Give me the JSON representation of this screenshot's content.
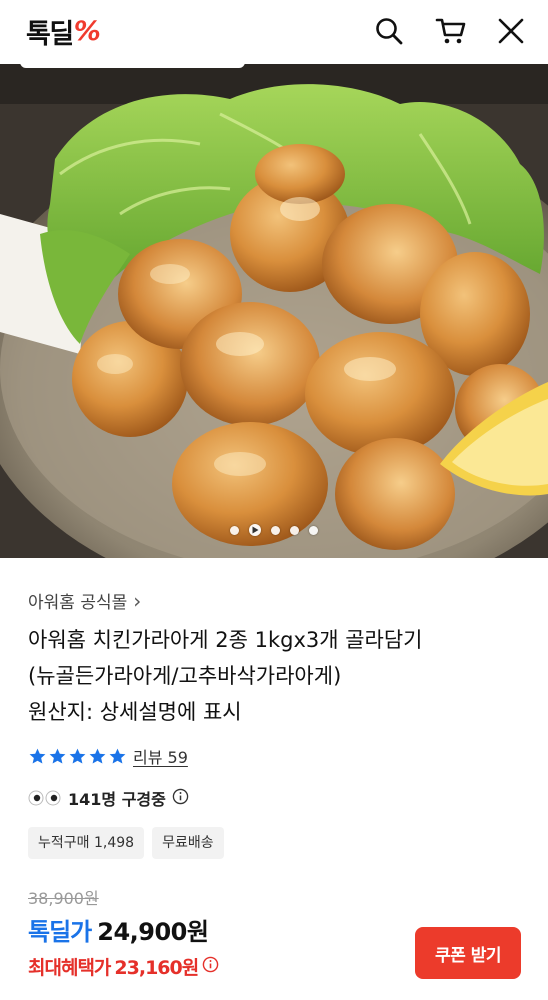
{
  "header": {
    "logo_text": "톡딜",
    "logo_mark": "%",
    "icons": [
      "search-icon",
      "cart-icon",
      "close-icon"
    ]
  },
  "carousel": {
    "slide_count": 5,
    "active_index": 1,
    "has_video": true
  },
  "product": {
    "seller": "아워홈 공식몰",
    "seller_chevron": "›",
    "title_lines": [
      "아워홈 치킨가라아게 2종 1kgx3개 골라담기",
      "(뉴골든가라아게/고추바삭가라아게)",
      "원산지: 상세설명에 표시"
    ],
    "rating_stars": 5,
    "review_label": "리뷰 59",
    "viewing_text": "141명 구경중",
    "badges": [
      "누적구매 1,498",
      "무료배송"
    ],
    "original_price": "38,900원",
    "deal_label": "톡딜가",
    "deal_price": "24,900원",
    "max_benefit_label": "최대혜택가",
    "max_benefit_price": "23,160원"
  },
  "actions": {
    "coupon_button": "쿠폰 받기"
  },
  "colors": {
    "accent_blue": "#1a73e8",
    "accent_red": "#e5302a",
    "coupon_bg": "#ec3b2b",
    "star": "#1a73e8"
  }
}
